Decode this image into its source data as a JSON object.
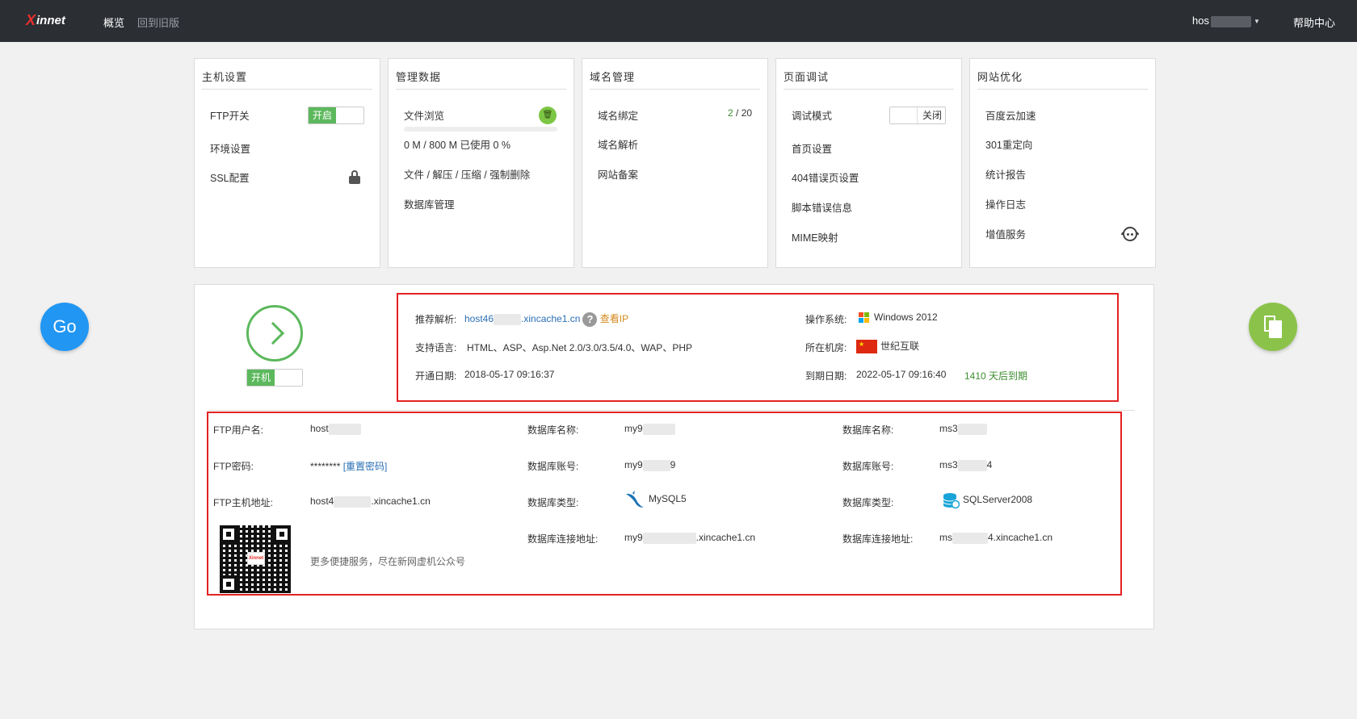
{
  "topbar": {
    "logo": "innet",
    "logo_x": "X",
    "nav_overview": "概览",
    "nav_old": "回到旧版",
    "user": "hos",
    "help": "帮助中心"
  },
  "panels": {
    "host": {
      "title": "主机设置",
      "ftp_switch": "FTP开关",
      "ftp_toggle": "开启",
      "env": "环境设置",
      "ssl": "SSL配置"
    },
    "data": {
      "title": "管理数据",
      "file_browse": "文件浏览",
      "usage": "0 M / 800 M 已使用 0 %",
      "file_ops": "文件 / 解压 / 压缩 / 强制删除",
      "db_manage": "数据库管理"
    },
    "domain": {
      "title": "域名管理",
      "bind": "域名绑定",
      "bind_used": "2",
      "bind_total": " / 20",
      "resolve": "域名解析",
      "icp": "网站备案"
    },
    "debug": {
      "title": "页面调试",
      "debug_mode": "调试模式",
      "debug_toggle": "关闭",
      "homepage": "首页设置",
      "err404": "404错误页设置",
      "script_err": "脚本错误信息",
      "mime": "MIME映射"
    },
    "optimize": {
      "title": "网站优化",
      "baidu": "百度云加速",
      "redirect": "301重定向",
      "stats": "统计报告",
      "oplog": "操作日志",
      "value_added": "增值服务"
    }
  },
  "main": {
    "go": "Go",
    "power_toggle": "开机",
    "resolve_label": "推荐解析:",
    "resolve_prefix": "host46",
    "resolve_suffix": ".xincache1.cn",
    "view_ip": "查看IP",
    "os_label": "操作系统:",
    "os_value": "Windows 2012",
    "lang_label": "支持语言:",
    "lang_value": "HTML、ASP、Asp.Net 2.0/3.0/3.5/4.0、WAP、PHP",
    "idc_label": "所在机房:",
    "idc_value": "世纪互联",
    "open_label": "开通日期:",
    "open_value": "2018-05-17 09:16:37",
    "expire_label": "到期日期:",
    "expire_value": "2022-05-17 09:16:40",
    "expire_days": "1410 天后到期"
  },
  "details": {
    "ftp_user_label": "FTP用户名:",
    "ftp_user_value": "host",
    "ftp_pwd_label": "FTP密码:",
    "ftp_pwd_value": "********",
    "reset_pwd": "[重置密码]",
    "ftp_host_label": "FTP主机地址:",
    "ftp_host_prefix": "host4",
    "ftp_host_suffix": ".xincache1.cn",
    "qr_tagline": "更多便捷服务，尽在新网虚机公众号",
    "qr_logo": "Xinnet",
    "mysql": {
      "name_label": "数据库名称:",
      "name_value": "my9",
      "account_label": "数据库账号:",
      "account_prefix": "my9",
      "account_suffix": "9",
      "type_label": "数据库类型:",
      "type_value": "MySQL5",
      "addr_label": "数据库连接地址:",
      "addr_prefix": "my9",
      "addr_suffix": ".xincache1.cn"
    },
    "mssql": {
      "name_label": "数据库名称:",
      "name_value": "ms3",
      "account_label": "数据库账号:",
      "account_prefix": "ms3",
      "account_suffix": "4",
      "type_label": "数据库类型:",
      "type_value": "SQLServer2008",
      "addr_label": "数据库连接地址:",
      "addr_prefix": "ms",
      "addr_suffix": "4.xincache1.cn"
    }
  },
  "icons": {
    "lock": "lock-icon",
    "trash": "trash-icon",
    "support": "customer-service-icon",
    "power": "power-chevron-icon",
    "copy": "copy-icon",
    "windows": "windows-icon",
    "china_flag": "china-flag-icon",
    "mysql": "mysql-dolphin-icon",
    "sqlserver": "sqlserver-db-icon",
    "qr": "qr-code-icon",
    "help": "question-icon"
  },
  "colors": {
    "topbar": "#2b2e33",
    "accent_green": "#5cb85c",
    "go_blue": "#2196f3",
    "copy_green": "#8bc34a",
    "highlight_red": "#e52222",
    "link_blue": "#2a6fb5"
  }
}
